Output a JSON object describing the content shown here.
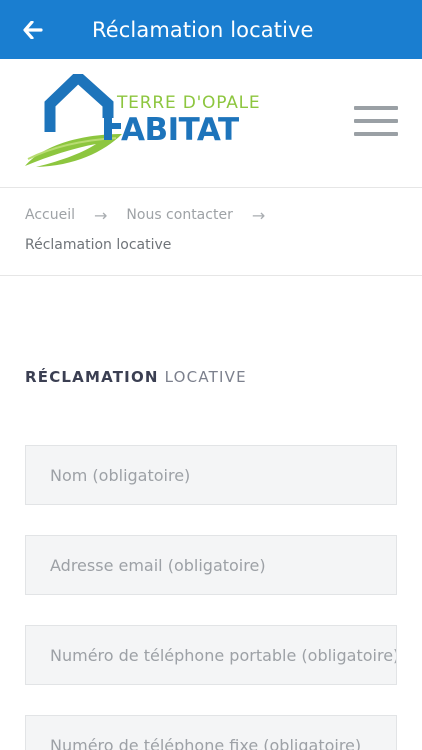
{
  "appbar": {
    "title": "Réclamation locative",
    "back_icon": "arrow-left-icon"
  },
  "header": {
    "logo_text_top": "TERRE D'OPALE",
    "logo_text_bottom": "HABITAT",
    "menu_icon": "hamburger-menu-icon"
  },
  "breadcrumb": {
    "items": [
      "Accueil",
      "Nous contacter",
      "Réclamation locative"
    ],
    "separator": "→"
  },
  "form": {
    "title_bold": "RÉCLAMATION",
    "title_light": "LOCATIVE",
    "fields": [
      {
        "placeholder": "Nom (obligatoire)",
        "value": ""
      },
      {
        "placeholder": "Adresse email (obligatoire)",
        "value": ""
      },
      {
        "placeholder": "Numéro de téléphone portable (obligatoire)",
        "value": ""
      },
      {
        "placeholder": "Numéro de téléphone fixe (obligatoire)",
        "value": ""
      }
    ]
  },
  "colors": {
    "appbar": "#1a7ed0",
    "logo_blue": "#1d74bb",
    "logo_green": "#8dc63f"
  }
}
